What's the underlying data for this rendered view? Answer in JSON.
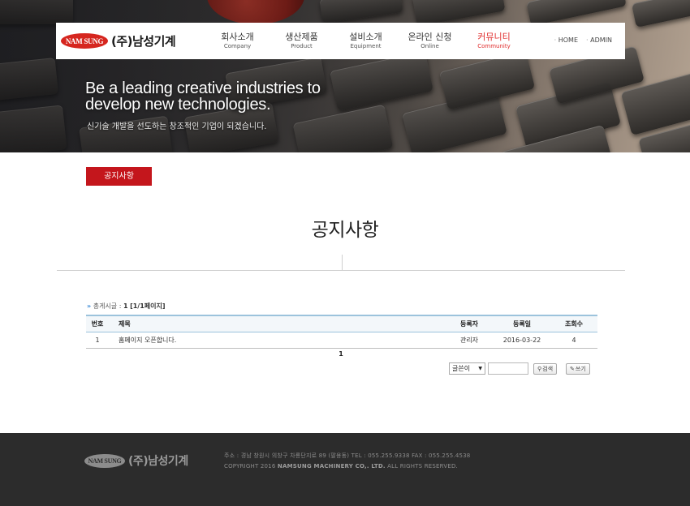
{
  "header": {
    "logo_mark": "NAM SUNG",
    "logo_text": "(주)남성기계",
    "menu": [
      {
        "ko": "회사소개",
        "en": "Company"
      },
      {
        "ko": "생산제품",
        "en": "Product"
      },
      {
        "ko": "설비소개",
        "en": "Equipment"
      },
      {
        "ko": "온라인 신청",
        "en": "Online"
      },
      {
        "ko": "커뮤니티",
        "en": "Community",
        "active": true
      }
    ],
    "util": {
      "home": "HOME",
      "admin": "ADMIN"
    }
  },
  "hero": {
    "title": "Be a leading creative industries to develop new technologies.",
    "subtitle": "신기술 개발을 선도하는 창조적인 기업이 되겠습니다."
  },
  "content": {
    "sub_tab": "공지사항",
    "page_title": "공지사항",
    "total_label": "총게시글 :",
    "total_count": "1",
    "total_pages": "[1/1페이지]",
    "table": {
      "headers": {
        "no": "번호",
        "subject": "제목",
        "author": "등록자",
        "date": "등록일",
        "hits": "조회수"
      },
      "rows": [
        {
          "no": "1",
          "subject": "홈페이지 오픈합니다.",
          "author": "관리자",
          "date": "2016-03-22",
          "hits": "4"
        }
      ]
    },
    "pager": "1",
    "search": {
      "field_selected": "글쓴이",
      "query": "",
      "search_label": "검색",
      "write_label": "쓰기"
    }
  },
  "footer": {
    "logo_mark": "NAM SUNG",
    "logo_text": "(주)남성기계",
    "address": "주소 : 경남 창원시 의창구 차룡단지로 89 (팔용동) TEL : 055.255.9338 FAX : 055.255.4538",
    "copyright_prefix": "COPYRIGHT 2016",
    "copyright_company": "NAMSUNG MACHINERY CO,. LTD.",
    "copyright_suffix": "ALL RIGHTS RESERVED."
  },
  "colors": {
    "accent_red": "#c4161c",
    "active_menu": "#e02d2d",
    "table_border": "#9cc3dc",
    "footer_bg": "#2c2c2c"
  }
}
